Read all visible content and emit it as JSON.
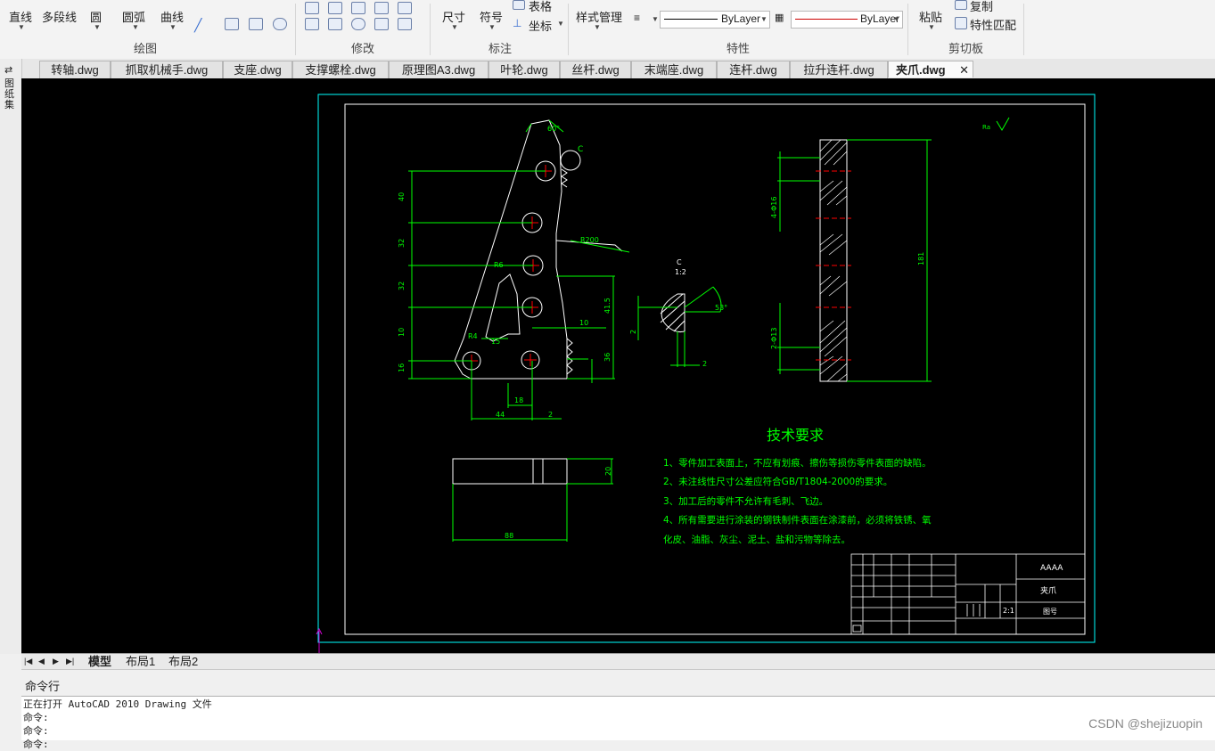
{
  "ribbon": {
    "draw": {
      "line": "直线",
      "polyline": "多段线",
      "circle": "圆",
      "arc": "圆弧",
      "curve": "曲线",
      "panel": "绘图"
    },
    "modify": {
      "panel": "修改"
    },
    "annotate": {
      "dimension": "尺寸",
      "symbol": "符号",
      "table": "表格",
      "coordinate": "坐标",
      "panel": "标注"
    },
    "properties": {
      "style_manager": "样式管理",
      "linetype": "ByLayer",
      "color": "ByLayer",
      "panel": "特性"
    },
    "clipboard": {
      "paste": "粘贴",
      "copy": "复制",
      "match": "特性匹配",
      "panel": "剪切板"
    }
  },
  "tabs": [
    {
      "label": "转轴.dwg"
    },
    {
      "label": "抓取机械手.dwg"
    },
    {
      "label": "支座.dwg"
    },
    {
      "label": "支撑螺栓.dwg"
    },
    {
      "label": "原理图A3.dwg"
    },
    {
      "label": "叶轮.dwg"
    },
    {
      "label": "丝杆.dwg"
    },
    {
      "label": "末端座.dwg"
    },
    {
      "label": "连杆.dwg"
    },
    {
      "label": "拉升连杆.dwg"
    },
    {
      "label": "夹爪.dwg"
    }
  ],
  "left_strip": {
    "label": "图纸集"
  },
  "drawing": {
    "dims": {
      "d40": "40",
      "d32a": "32",
      "d32b": "32",
      "d10v": "10",
      "d16": "16",
      "d15": "15",
      "d18": "18",
      "d44": "44",
      "d2": "2",
      "r200": "R200",
      "d60": "60°",
      "r4": "R4",
      "r6": "R6",
      "d41": "41.5",
      "d10": "10",
      "d36": "36",
      "d20": "20",
      "d88": "88",
      "phi16": "4-Φ16",
      "phi13": "2-Φ13",
      "d181": "181",
      "c": "C",
      "c_label": "C",
      "c_scale": "1:2",
      "d53": "53°",
      "d2a": "2",
      "d2b": "2",
      "rough": "Ra"
    },
    "tech_title": "技术要求",
    "tech_items": [
      "1、零件加工表面上，不应有划痕、擦伤等损伤零件表面的缺陷。",
      "2、未注线性尺寸公差应符合GB/T1804-2000的要求。",
      "3、加工后的零件不允许有毛刺、飞边。",
      "4、所有需要进行涂装的钢铁制件表面在涂漆前，必须将铁锈、氧",
      "化皮、油脂、灰尘、泥土、盐和污物等除去。"
    ],
    "title_block": {
      "company": "AAAA",
      "part": "夹爪",
      "scale": "2:1",
      "drawing_no": "图号"
    }
  },
  "layout_tabs": {
    "model": "模型",
    "layout1": "布局1",
    "layout2": "布局2"
  },
  "command": {
    "header": "命令行",
    "lines": [
      "正在打开 AutoCAD 2010 Drawing 文件",
      "命令:",
      "命令:",
      "命令:"
    ]
  },
  "watermark": "CSDN @shejizuopin",
  "colors": {
    "green": "#00ff00",
    "cyan": "#00ffff",
    "white": "#ffffff",
    "yellow": "#ffff00",
    "red": "#ff0000"
  }
}
